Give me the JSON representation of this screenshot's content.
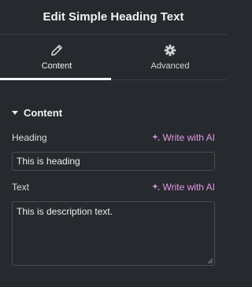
{
  "header": {
    "title": "Edit Simple Heading Text"
  },
  "tabs": [
    {
      "label": "Content",
      "icon": "pencil-icon",
      "active": true
    },
    {
      "label": "Advanced",
      "icon": "gear-icon",
      "active": false
    }
  ],
  "section": {
    "title": "Content",
    "expanded": true
  },
  "fields": {
    "heading": {
      "label": "Heading",
      "ai_label": "Write with AI",
      "value": "This is heading"
    },
    "text": {
      "label": "Text",
      "ai_label": "Write with AI",
      "value": "This is description text."
    }
  },
  "colors": {
    "background": "#26292d",
    "border": "#3b3f44",
    "ai_accent": "#e39ae6",
    "text": "#e6e8ea"
  }
}
